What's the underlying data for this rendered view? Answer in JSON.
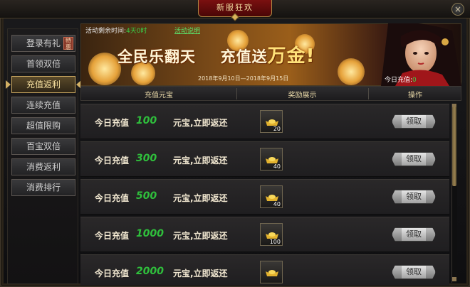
{
  "window": {
    "title": "新服狂欢",
    "close_glyph": "×"
  },
  "sidebar": {
    "items": [
      {
        "label": "登录有礼",
        "tag": "特惠"
      },
      {
        "label": "首领双倍"
      },
      {
        "label": "充值返利"
      },
      {
        "label": "连续充值"
      },
      {
        "label": "超值限购"
      },
      {
        "label": "百宝双倍"
      },
      {
        "label": "消费返利"
      },
      {
        "label": "消费排行"
      }
    ],
    "active_index": 2
  },
  "banner": {
    "timer_label": "活动剩余时间:",
    "timer_value": "4天0时",
    "rules_link": "活动说明",
    "slogan_a": "全民乐翻天",
    "slogan_b": "充值送",
    "slogan_c": "万金!",
    "date_range": "2018年9月10日—2018年9月15日",
    "today_label": "今日充值:",
    "today_value": "0"
  },
  "table": {
    "headers": [
      "充值元宝",
      "奖励展示",
      "操作"
    ],
    "rows": [
      {
        "prefix": "今日充值",
        "amount": "100",
        "suffix": "元宝,立即返还",
        "reward": "20",
        "action": "领取"
      },
      {
        "prefix": "今日充值",
        "amount": "300",
        "suffix": "元宝,立即返还",
        "reward": "40",
        "action": "领取"
      },
      {
        "prefix": "今日充值",
        "amount": "500",
        "suffix": "元宝,立即返还",
        "reward": "40",
        "action": "领取"
      },
      {
        "prefix": "今日充值",
        "amount": "1000",
        "suffix": "元宝,立即返还",
        "reward": "100",
        "action": "领取"
      },
      {
        "prefix": "今日充值",
        "amount": "2000",
        "suffix": "元宝,立即返还",
        "reward": "",
        "action": "领取"
      }
    ]
  },
  "colors": {
    "accent_gold": "#d2b064",
    "amount_green": "#2fbf3c",
    "title_red": "#7a1010"
  },
  "icons": {
    "reward": "gold-ingot-icon",
    "close": "close-icon"
  }
}
